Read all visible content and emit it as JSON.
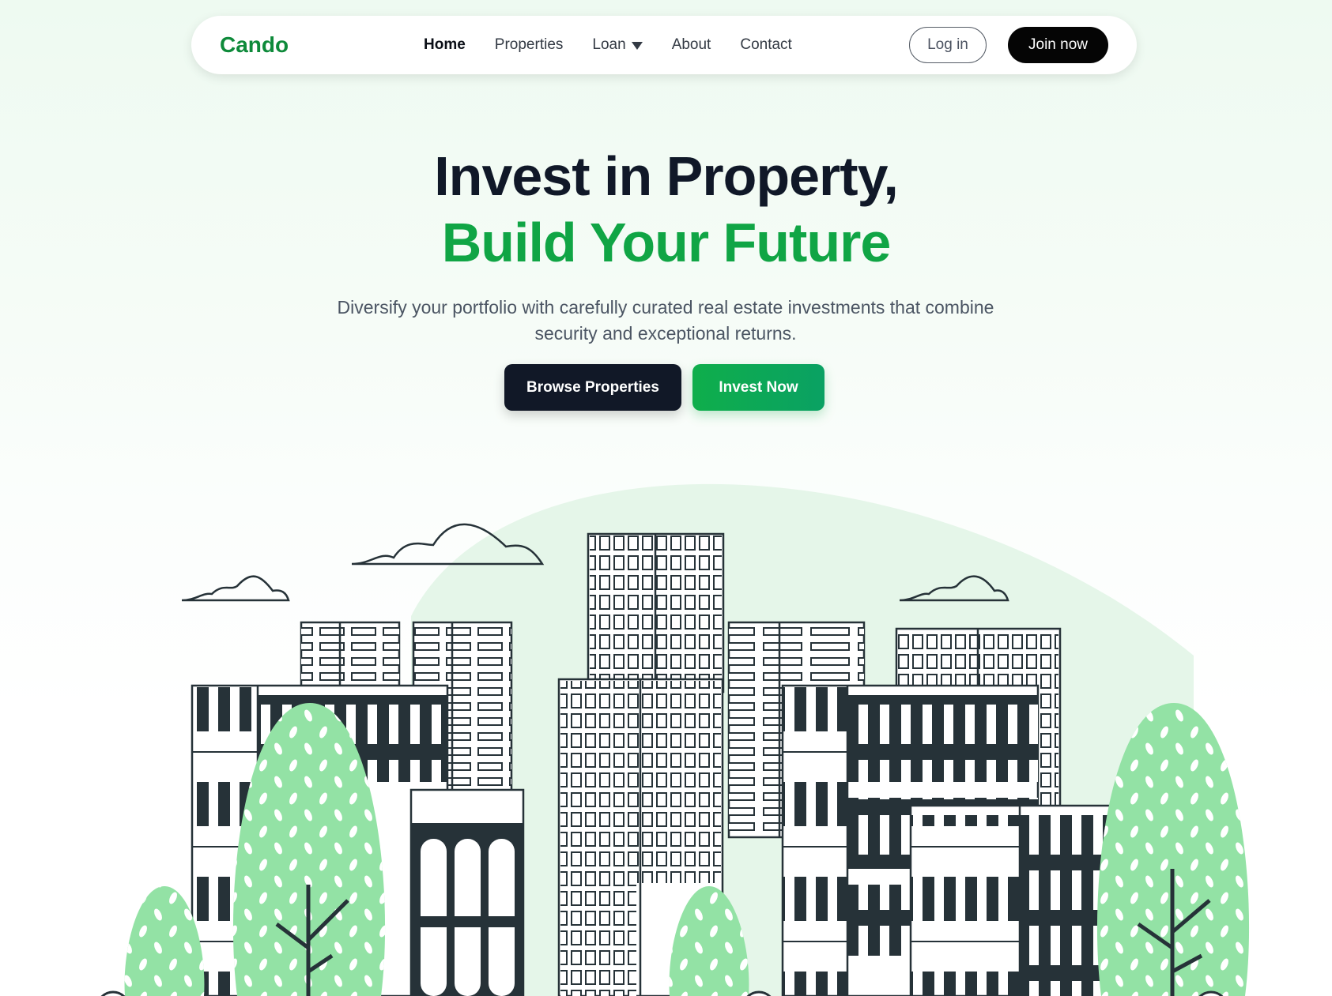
{
  "nav": {
    "logo": "Cando",
    "links": [
      {
        "label": "Home",
        "active": true
      },
      {
        "label": "Properties",
        "active": false
      },
      {
        "label": "Loan",
        "active": false,
        "dropdown": true
      },
      {
        "label": "About",
        "active": false
      },
      {
        "label": "Contact",
        "active": false
      }
    ],
    "login": "Log in",
    "join": "Join now"
  },
  "hero": {
    "title_line1": "Invest in Property,",
    "title_line2": "Build Your Future",
    "subtitle": "Diversify your portfolio with carefully curated real estate investments that combine security and exceptional returns.",
    "primary_button": "Browse Properties",
    "secondary_button": "Invest Now"
  },
  "illustration": {
    "subject": "city skyline with buildings, trees and clouds",
    "icons": [
      "cloud-icon",
      "building-icon",
      "tree-icon"
    ]
  },
  "colors": {
    "brand": "#0e8a3a",
    "accent": "#10a545",
    "dark": "#111827",
    "tree": "#93e2a5",
    "building_dark": "#263238"
  }
}
